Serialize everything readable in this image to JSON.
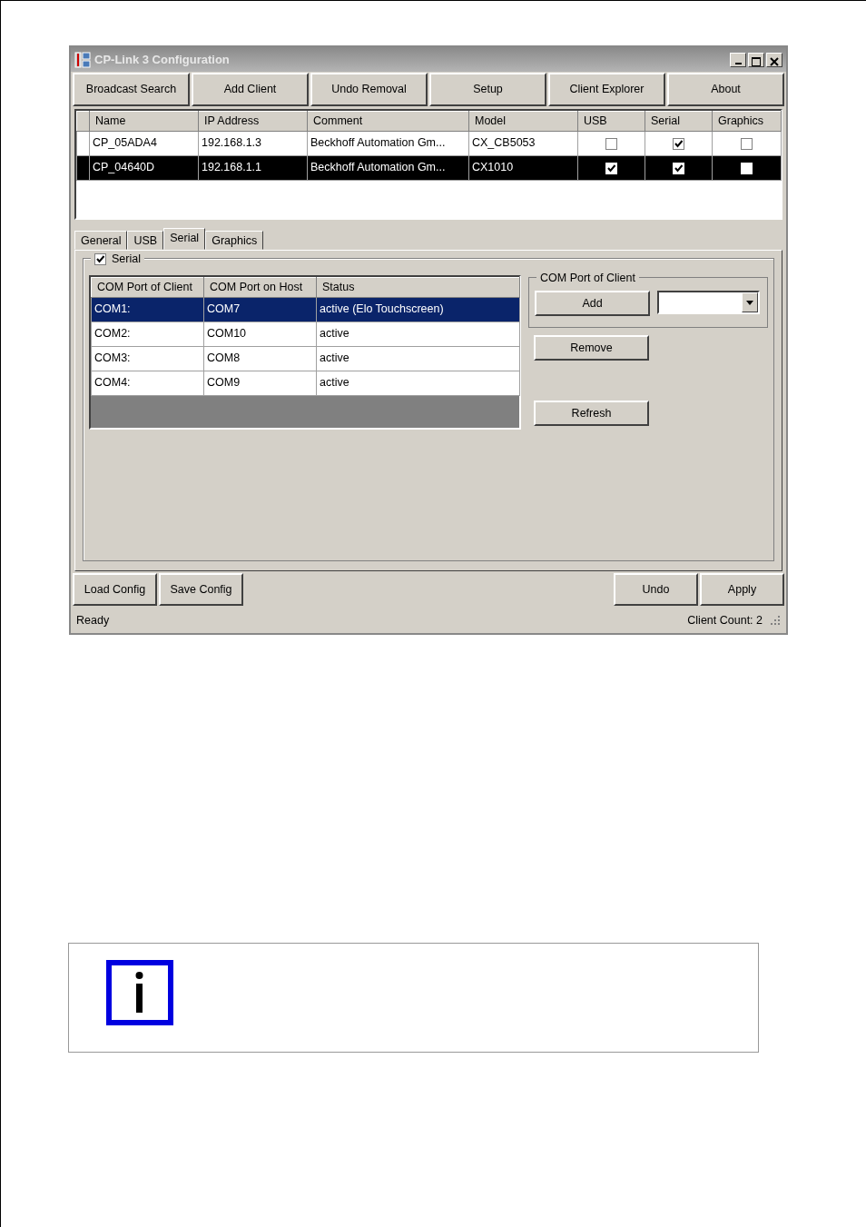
{
  "window": {
    "title": "CP-Link 3 Configuration"
  },
  "toolbar": [
    "Broadcast Search",
    "Add Client",
    "Undo Removal",
    "Setup",
    "Client Explorer",
    "About"
  ],
  "clients": {
    "columns": [
      "Name",
      "IP Address",
      "Comment",
      "Model",
      "USB",
      "Serial",
      "Graphics"
    ],
    "rows": [
      {
        "name": "CP_05ADA4",
        "ip": "192.168.1.3",
        "comment": "Beckhoff Automation Gm...",
        "model": "CX_CB5053",
        "usb": false,
        "serial": true,
        "graphics": false,
        "selected": false
      },
      {
        "name": "CP_04640D",
        "ip": "192.168.1.1",
        "comment": "Beckhoff Automation Gm...",
        "model": "CX1010",
        "usb": true,
        "serial": true,
        "graphics": false,
        "selected": true
      }
    ]
  },
  "tabs": [
    {
      "label": "General",
      "selected": false
    },
    {
      "label": "USB",
      "selected": false
    },
    {
      "label": "Serial",
      "selected": true
    },
    {
      "label": "Graphics",
      "selected": false
    }
  ],
  "serial": {
    "label": "Serial",
    "checked": true,
    "columns": [
      "COM Port of Client",
      "COM Port on Host",
      "Status"
    ],
    "rows": [
      {
        "client": "COM1:",
        "host": "COM7",
        "status": "active (Elo Touchscreen)",
        "selected": true
      },
      {
        "client": "COM2:",
        "host": "COM10",
        "status": "active",
        "selected": false
      },
      {
        "client": "COM3:",
        "host": "COM8",
        "status": "active",
        "selected": false
      },
      {
        "client": "COM4:",
        "host": "COM9",
        "status": "active",
        "selected": false
      }
    ],
    "port_group": {
      "title": "COM Port of Client",
      "add": "Add"
    },
    "remove": "Remove",
    "refresh": "Refresh"
  },
  "bottom_left": [
    "Load Config",
    "Save Config"
  ],
  "bottom_right": [
    "Undo",
    "Apply"
  ],
  "status_bar": {
    "text": "Ready",
    "count": "Client Count: 2"
  }
}
